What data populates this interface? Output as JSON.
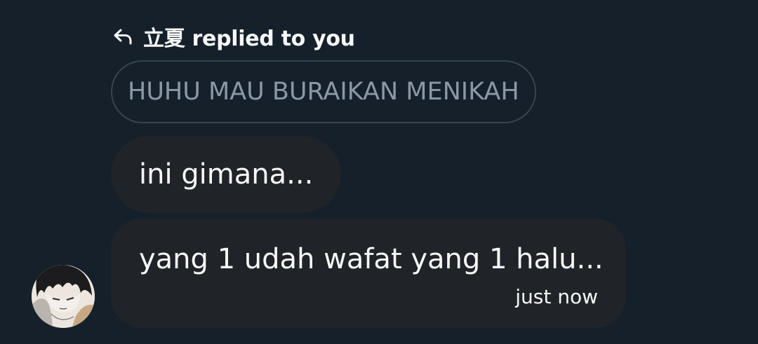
{
  "reply_header": {
    "icon": "reply-arrow-icon",
    "text": "立夏 replied to you"
  },
  "quoted_message": {
    "text": "HUHU MAU BURAIKAN MENIKAH"
  },
  "messages": [
    {
      "text": "ini gimana..."
    },
    {
      "text": "yang 1 udah wafat yang 1 halu...",
      "timestamp": "just now"
    }
  ],
  "avatar": {
    "icon": "user-avatar-anime-drawing"
  },
  "colors": {
    "background": "#15202b",
    "bubble": "#202327",
    "quoted_border": "#38444d",
    "quoted_text": "#8b98a5",
    "text": "#f7f9f9"
  }
}
